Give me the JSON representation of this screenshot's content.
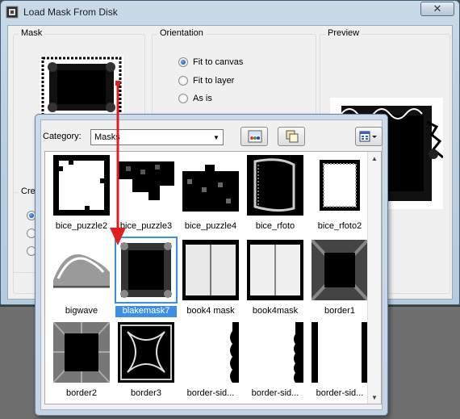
{
  "window": {
    "title": "Load Mask From Disk",
    "close_label": "✕"
  },
  "mask_group": {
    "label": "Mask"
  },
  "orientation": {
    "label": "Orientation",
    "options": [
      {
        "label": "Fit to canvas",
        "checked": true
      },
      {
        "label": "Fit to layer",
        "checked": false
      },
      {
        "label": "As is",
        "checked": false
      }
    ]
  },
  "preview_group": {
    "label": "Preview"
  },
  "create_group": {
    "label": "Crea"
  },
  "picker": {
    "category_label": "Category:",
    "category_value": "Masks",
    "items": [
      {
        "name": "bice_puzzle2",
        "selected": false
      },
      {
        "name": "bice_puzzle3",
        "selected": false
      },
      {
        "name": "bice_puzzle4",
        "selected": false
      },
      {
        "name": "bice_rfoto",
        "selected": false
      },
      {
        "name": "bice_rfoto2",
        "selected": false
      },
      {
        "name": "bigwave",
        "selected": false
      },
      {
        "name": "blakemask7",
        "selected": true
      },
      {
        "name": "book4 mask",
        "selected": false
      },
      {
        "name": "book4mask",
        "selected": false
      },
      {
        "name": "border1",
        "selected": false
      },
      {
        "name": "border2",
        "selected": false
      },
      {
        "name": "border3",
        "selected": false
      },
      {
        "name": "border-sid...",
        "selected": false
      },
      {
        "name": "border-sid...",
        "selected": false
      },
      {
        "name": "border-sid...",
        "selected": false
      }
    ]
  },
  "colors": {
    "arrow": "#e02020",
    "selection": "#3d8ee6"
  },
  "icons": {
    "app": "mask-app-icon",
    "toolbar": [
      "palette-icon",
      "copy-icon",
      "view-mode-icon"
    ]
  }
}
